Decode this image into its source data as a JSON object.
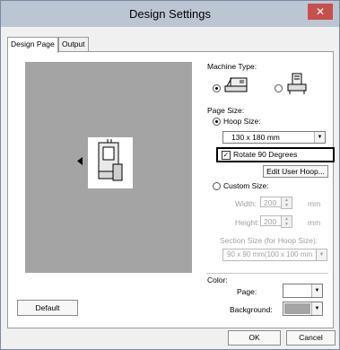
{
  "window": {
    "title": "Design Settings",
    "close_glyph": "✕"
  },
  "tabs": [
    {
      "label": "Design Page"
    },
    {
      "label": "Output"
    }
  ],
  "machine_type": {
    "label": "Machine Type:"
  },
  "page_size": {
    "label": "Page Size:",
    "hoop_size_label": "Hoop Size:",
    "hoop_size_value": "130 x 180 mm",
    "rotate_label": "Rotate 90 Degrees",
    "rotate_checked": true,
    "edit_user_hoop_label": "Edit User Hoop...",
    "custom_size_label": "Custom Size:",
    "width_label": "Width:",
    "width_value": "200",
    "height_label": "Height:",
    "height_value": "200",
    "unit": "mm",
    "section_size_label": "Section Size (for Hoop Size):",
    "section_size_value": "90 x  90 mm(100 x 100 mm"
  },
  "color": {
    "label": "Color:",
    "page_label": "Page:",
    "page_color": "#ffffff",
    "background_label": "Background:",
    "background_color": "#a4a4a4"
  },
  "buttons": {
    "default_label": "Default",
    "ok_label": "OK",
    "cancel_label": "Cancel"
  }
}
